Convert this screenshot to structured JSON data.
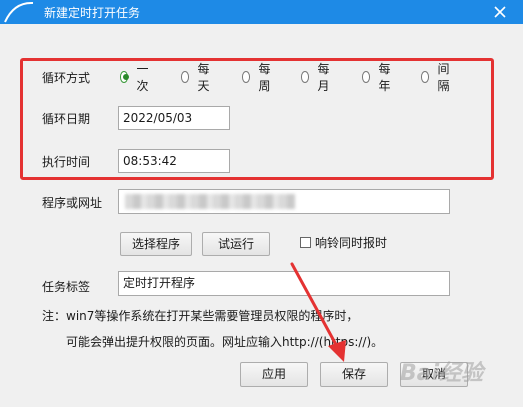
{
  "window": {
    "title": "新建定时打开任务",
    "close_symbol": "✕"
  },
  "cycle": {
    "label": "循环方式",
    "options": [
      "一次",
      "每天",
      "每周",
      "每月",
      "每年",
      "间隔"
    ],
    "selected_index": 0
  },
  "date": {
    "label": "循环日期",
    "value": "2022/05/03"
  },
  "time": {
    "label": "执行时间",
    "value": "08:53:42"
  },
  "program": {
    "label": "程序或网址",
    "value": ""
  },
  "actions": {
    "select_program": "选择程序",
    "test_run": "试运行",
    "ring_checkbox": "响铃同时报时",
    "ring_checked": false
  },
  "task": {
    "label": "任务标签",
    "value": "定时打开程序"
  },
  "notes": {
    "line1": "注：win7等操作系统在打开某些需要管理员权限的程序时，",
    "line2": "可能会弹出提升权限的页面。网址应输入http://(https://)。"
  },
  "footer": {
    "apply": "应用",
    "save": "保存",
    "cancel": "取消"
  },
  "colors": {
    "titlebar": "#1e8ae6",
    "highlight": "#e43232",
    "radio_selected": "#2b8a2b"
  },
  "icons": {
    "app": "app-logo-icon",
    "close": "close-icon",
    "annotation": "red-arrow-icon"
  },
  "watermark": "Bai经验"
}
